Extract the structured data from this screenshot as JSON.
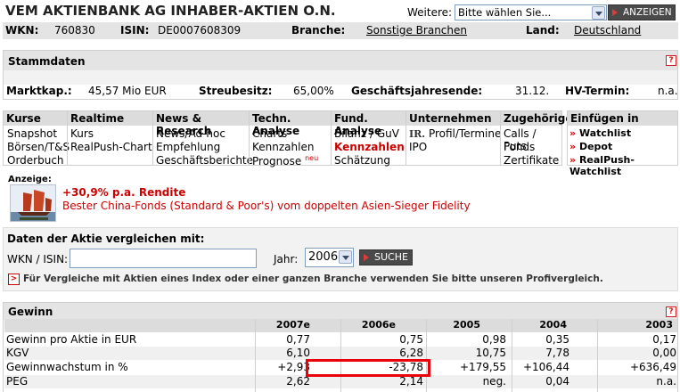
{
  "header": {
    "title": "VEM AKTIENBANK AG INHABER-AKTIEN O.N.",
    "weitere_label": "Weitere:",
    "select_value": "Bitte wählen Sie...",
    "button": "ANZEIGEN"
  },
  "info": {
    "wkn_label": "WKN:",
    "wkn": "760830",
    "isin_label": "ISIN:",
    "isin": "DE0007608309",
    "branche_label": "Branche:",
    "branche": "Sonstige Branchen",
    "land_label": "Land:",
    "land": "Deutschland"
  },
  "stammdaten": {
    "title": "Stammdaten",
    "help": "?",
    "marktkap_label": "Marktkap.:",
    "marktkap": "45,57 Mio EUR",
    "streubesitz_label": "Streubesitz:",
    "streubesitz": "65,00%",
    "gj_label": "Geschäftsjahresende:",
    "gj": "31.12.",
    "hv_label": "HV-Termin:",
    "hv": "n.a."
  },
  "nav": {
    "kurse": {
      "head": "Kurse",
      "items": [
        "Snapshot",
        "Börsen/T&S",
        "Orderbuch"
      ]
    },
    "realtime": {
      "head": "Realtime",
      "items": [
        "Kurs",
        "RealPush-Chart"
      ]
    },
    "news": {
      "head": "News & Research",
      "items": [
        "News/Ad-hoc",
        "Empfehlung",
        "Geschäftsberichte"
      ]
    },
    "technisch": {
      "head": "Techn. Analyse",
      "items": [
        "Charts",
        "Kennzahlen",
        "Prognose"
      ],
      "neu": "neu"
    },
    "fundamental": {
      "head": "Fund. Analyse",
      "items": [
        "Bilanz / GuV",
        "Kennzahlen",
        "Schätzung"
      ]
    },
    "unternehmen": {
      "head": "Unternehmen",
      "logo": "IR.",
      "items": [
        "Profil/Termine",
        "IPO"
      ]
    },
    "zugehoerige": {
      "head": "Zugehörige",
      "items": [
        "Calls / Puts",
        "Fonds",
        "Zertifikate"
      ]
    },
    "einfuegen": {
      "head": "Einfügen in",
      "items": [
        "Watchlist",
        "Depot",
        "RealPush-Watchlist"
      ]
    }
  },
  "ad": {
    "label": "Anzeige:",
    "headline": "+30,9% p.a. Rendite",
    "text": "Bester China-Fonds (Standard & Poor's) vom doppelten Asien-Sieger Fidelity"
  },
  "compare": {
    "title": "Daten der Aktie vergleichen mit:",
    "wkn_label": "WKN / ISIN:",
    "wkn_value": "",
    "jahr_label": "Jahr:",
    "jahr_value": "2006",
    "button": "SUCHE",
    "hint_marker": ">",
    "hint": "Für Vergleiche mit Aktien eines Index oder einer ganzen Branche verwenden Sie bitte unseren Profivergleich."
  },
  "gewinn": {
    "title": "Gewinn",
    "help": "?",
    "columns": [
      "2007e",
      "2006e",
      "2005",
      "2004",
      "2003"
    ],
    "rows": [
      {
        "label": "Gewinn pro Aktie in EUR",
        "values": [
          "0,77",
          "0,75",
          "0,98",
          "0,35",
          "0,17"
        ]
      },
      {
        "label": "KGV",
        "values": [
          "6,10",
          "6,28",
          "10,75",
          "7,78",
          "0,00"
        ]
      },
      {
        "label": "Gewinnwachstum in %",
        "values": [
          "+2,93",
          "-23,78",
          "+179,55",
          "+106,44",
          "+636,49"
        ]
      },
      {
        "label": "PEG",
        "values": [
          "2,62",
          "2,14",
          "neg.",
          "0,04",
          "n.a."
        ]
      }
    ],
    "highlight_color": "#e8000b"
  }
}
